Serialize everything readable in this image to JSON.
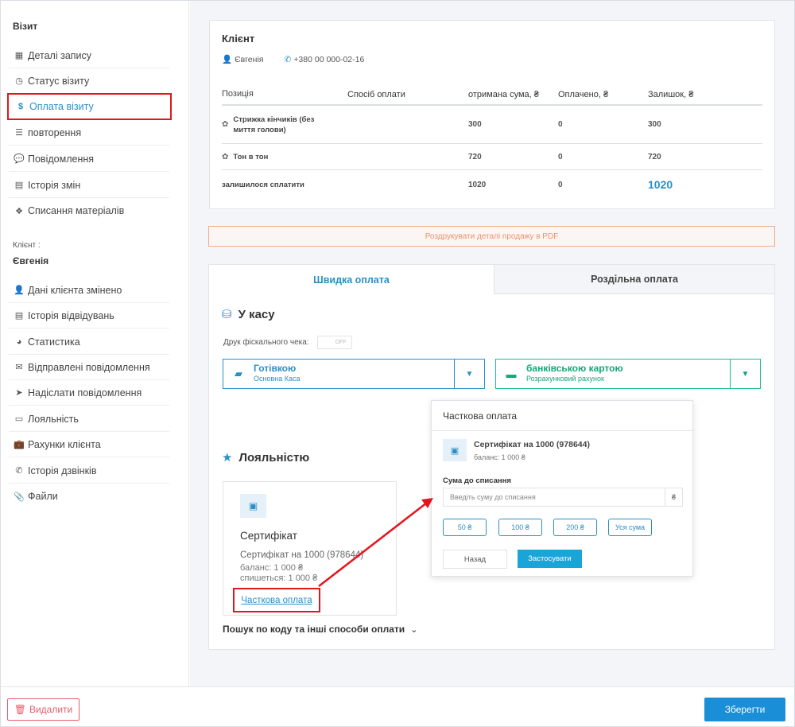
{
  "sidebar": {
    "visit_heading": "Візит",
    "visit_items": [
      {
        "label": "Деталі запису",
        "icon": "calendar-icon"
      },
      {
        "label": "Статус візиту",
        "icon": "clock-icon"
      },
      {
        "label": "Оплата візиту",
        "icon": "dollar-icon"
      },
      {
        "label": "повторення",
        "icon": "list-icon"
      },
      {
        "label": "Повідомлення",
        "icon": "chat-icon"
      },
      {
        "label": "Історія змін",
        "icon": "document-icon"
      },
      {
        "label": "Списання матеріалів",
        "icon": "cubes-icon"
      }
    ],
    "client_caption": "Клієнт :",
    "client_name": "Євгенія",
    "client_items": [
      {
        "label": "Дані клієнта змінено",
        "icon": "user-icon"
      },
      {
        "label": "Історія відвідувань",
        "icon": "list-alt-icon"
      },
      {
        "label": "Статистика",
        "icon": "pie-chart-icon"
      },
      {
        "label": "Відправлені повідомлення",
        "icon": "envelope-icon"
      },
      {
        "label": "Надіслати повідомлення",
        "icon": "send-icon"
      },
      {
        "label": "Лояльність",
        "icon": "card-icon"
      },
      {
        "label": "Рахунки клієнта",
        "icon": "briefcase-icon"
      },
      {
        "label": "Історія дзвінків",
        "icon": "phone-icon"
      },
      {
        "label": "Файли",
        "icon": "paperclip-icon"
      }
    ]
  },
  "client": {
    "title": "Клієнт",
    "name": "Євгенія",
    "phone": "+380 00 000-02-16"
  },
  "table": {
    "headers": [
      "Позиція",
      "Спосіб оплати",
      "отримана сума, ₴",
      "Оплачено, ₴",
      "Залишок, ₴"
    ],
    "rows": [
      {
        "position": "Стрижка кінчиків (без миття голови)",
        "received": "300",
        "paid": "0",
        "rest": "300"
      },
      {
        "position": "Тон в тон",
        "received": "720",
        "paid": "0",
        "rest": "720"
      }
    ],
    "total": {
      "label": "залишилося сплатити",
      "received": "1020",
      "paid": "0",
      "rest": "1020"
    }
  },
  "pdf_button": "Роздрукувати деталі продажу в PDF",
  "tabs": [
    "Швидка оплата",
    "Роздільна оплата"
  ],
  "cashbox": {
    "title": "У касу",
    "fiscal_label": "Друк фіскального чека:",
    "toggle_state": "OFF",
    "cash": {
      "name": "Готівкою",
      "sub": "Основна Каса"
    },
    "card": {
      "name": "банківською картою",
      "sub": "Розрахунковий рахунок"
    }
  },
  "loyalty": {
    "title": "Лояльністю",
    "cert_title": "Сертифікат",
    "cert_name": "Сертифікат на 1000 (978644)",
    "balance": "баланс: 1 000 ₴",
    "charge": "спишеться: 1 000 ₴",
    "partial_link": "Часткова оплата"
  },
  "search_more": "Пошук по коду та інші способи оплати",
  "popup": {
    "title": "Часткова оплата",
    "cert_name": "Сертифікат на 1000 (978644)",
    "balance": "баланс: 1 000 ₴",
    "amount_label": "Сума до списання",
    "amount_placeholder": "Введіть суму до списання",
    "amount_value": "",
    "currency": "₴",
    "chips": [
      "50 ₴",
      "100 ₴",
      "200 ₴",
      "Уся сума"
    ],
    "back": "Назад",
    "apply": "Застосувати"
  },
  "footer": {
    "delete": "Видалити",
    "save": "Зберегти"
  },
  "colors": {
    "accent": "#2a8fc7",
    "green": "#10a878",
    "highlight": "#e4161d",
    "danger": "#e4606a",
    "primary_button": "#1a8fd8"
  }
}
